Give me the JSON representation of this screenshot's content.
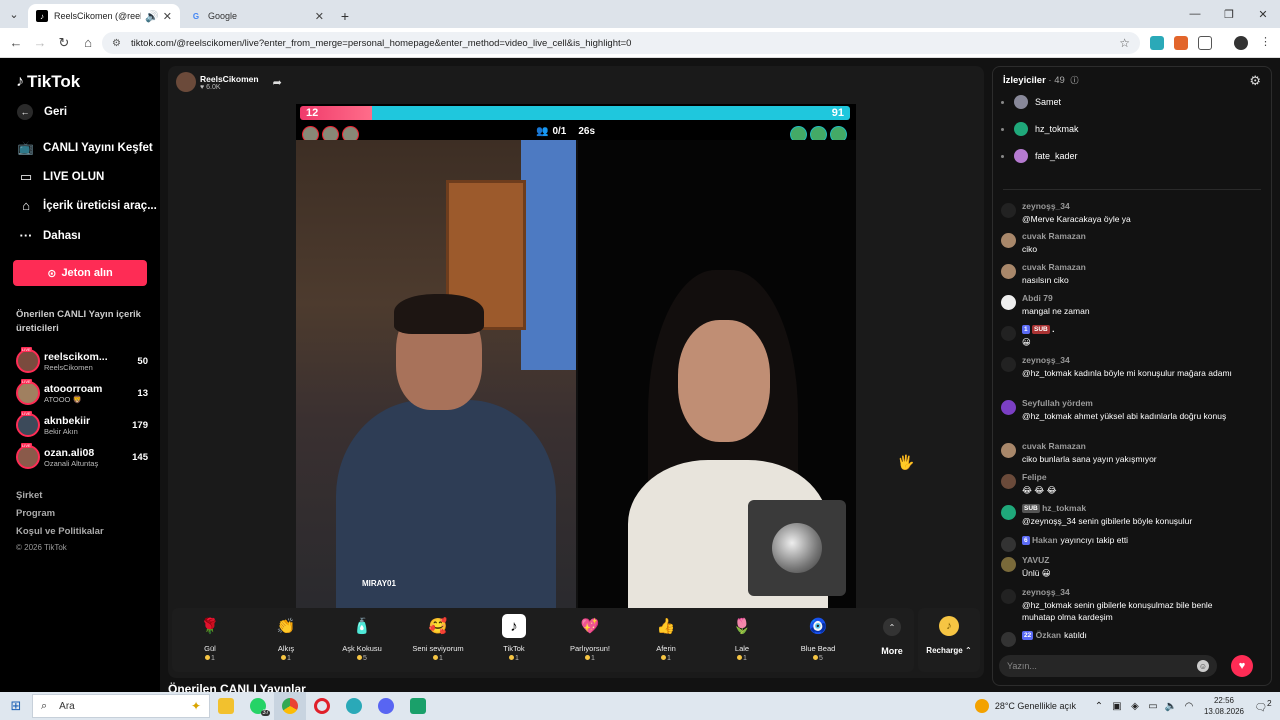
{
  "browser": {
    "tabs": [
      {
        "title": "ReelsCikomen (@reelscikomen)",
        "active": true
      },
      {
        "title": "Google",
        "active": false
      }
    ],
    "url": "tiktok.com/@reelscikomen/live?enter_from_merge=personal_homepage&enter_method=video_live_cell&is_highlight=0"
  },
  "sidebar": {
    "logo": "TikTok",
    "back": "Geri",
    "items": [
      {
        "label": "CANLI Yayını Keşfet",
        "icon": "live-explore-icon"
      },
      {
        "label": "LIVE OLUN",
        "icon": "video-camera-icon"
      },
      {
        "label": "İçerik üreticisi araç...",
        "icon": "creator-tools-icon"
      },
      {
        "label": "Dahası",
        "icon": "more-dots-icon"
      }
    ],
    "jeton_button": "Jeton alın",
    "suggest_title": "Önerilen CANLI Yayın içerik üreticileri",
    "creators": [
      {
        "name": "reelscikom...",
        "sub": "ReelsCikomen",
        "count": "50"
      },
      {
        "name": "atooorroam",
        "sub": "ATOOO 🦁",
        "count": "13"
      },
      {
        "name": "aknbekiir",
        "sub": "Bekir Akın",
        "count": "179"
      },
      {
        "name": "ozan.ali08",
        "sub": "Ozanali Altuntaş",
        "count": "145"
      }
    ],
    "footer": [
      "Şirket",
      "Program",
      "Koşul ve Politikalar"
    ],
    "copyright": "© 2026 TikTok"
  },
  "stage": {
    "host_name": "ReelsCikomen",
    "host_likes": "♥ 6.0K",
    "pk": {
      "left_score": "12",
      "right_score": "91",
      "left_share": 0.13,
      "viewers": "0/1",
      "timer": "26s"
    },
    "cam_label": "MIRAY01",
    "gifts": [
      {
        "name": "Gül",
        "price": "1",
        "icon": "🌹"
      },
      {
        "name": "Alkış",
        "price": "1",
        "icon": "👏"
      },
      {
        "name": "Aşk Kokusu",
        "price": "5",
        "icon": "🧴"
      },
      {
        "name": "Seni seviyorum",
        "price": "1",
        "icon": "🥰"
      },
      {
        "name": "TikTok",
        "price": "1",
        "icon": "♪"
      },
      {
        "name": "Parlıyorsun!",
        "price": "1",
        "icon": "💖"
      },
      {
        "name": "Aferin",
        "price": "1",
        "icon": "👍"
      },
      {
        "name": "Lale",
        "price": "1",
        "icon": "🌷"
      },
      {
        "name": "Blue Bead",
        "price": "5",
        "icon": "🧿"
      }
    ],
    "more_label": "More",
    "recharge_label": "Recharge ⌃",
    "below_title": "Önerilen CANLI Yayınlar"
  },
  "chat": {
    "viewers_label": "İzleyiciler",
    "viewers_count": "· 49",
    "top_viewers": [
      "Samet",
      "hz_tokmak",
      "fate_kader"
    ],
    "messages": [
      {
        "user": "zeynoşş_34",
        "text": "@Merve Karacakaya öyle ya"
      },
      {
        "user": "cuvak Ramazan",
        "text": "ciko"
      },
      {
        "user": "cuvak Ramazan",
        "text": "nasılsın ciko"
      },
      {
        "user": "Abdi 79",
        "text": "mangal ne zaman"
      },
      {
        "user": "",
        "text": "😀",
        "badges": [
          "1",
          "SUB"
        ]
      },
      {
        "user": "zeynoşş_34",
        "text": "@hz_tokmak kadınla böyle mi konuşulur mağara adamı"
      },
      {
        "user": "Seyfullah yördem",
        "text": "@hz_tokmak ahmet yüksel abi kadınlarla doğru konuş"
      },
      {
        "user": "cuvak Ramazan",
        "text": "ciko bunlarla sana yayın yakışmıyor"
      },
      {
        "user": "Felipe",
        "text": "😂 😂 😂"
      },
      {
        "user": "hz_tokmak",
        "text": "@zeynoşş_34 senin gibilerle böyle konuşulur",
        "badges": [
          "SUB"
        ]
      },
      {
        "user": "Hakan",
        "text": "yayıncıyı takip etti",
        "badges": [
          "6"
        ]
      },
      {
        "user": "YAVUZ",
        "text": "Ünlü 😀"
      },
      {
        "user": "zeynoşş_34",
        "text": "@hz_tokmak senin gibilerle konuşulmaz bile benle muhatap olma kardeşim"
      },
      {
        "user": "Özkan",
        "text": "katıldı",
        "badges": [
          "22"
        ]
      }
    ],
    "input_placeholder": "Yazın..."
  },
  "taskbar": {
    "search_placeholder": "Ara",
    "whatsapp_badge": "37",
    "weather": "28°C  Genellikle açık",
    "time": "22:56",
    "date": "13.08.2026",
    "notif_count": "2"
  },
  "colors": {
    "accent": "#fe2c55",
    "pk_blue": "#1fc7dd",
    "coin": "#f6c543"
  }
}
